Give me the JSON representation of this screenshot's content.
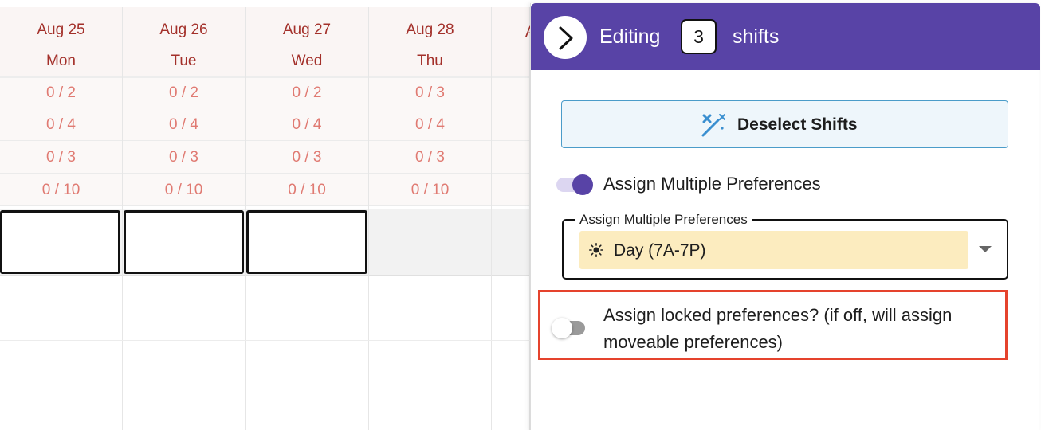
{
  "schedule": {
    "days": [
      {
        "date": "Aug 25",
        "weekday": "Mon",
        "counts": [
          "0 / 2",
          "0 / 4",
          "0 / 3",
          "0 / 10"
        ]
      },
      {
        "date": "Aug 26",
        "weekday": "Tue",
        "counts": [
          "0 / 2",
          "0 / 4",
          "0 / 3",
          "0 / 10"
        ]
      },
      {
        "date": "Aug 27",
        "weekday": "Wed",
        "counts": [
          "0 / 2",
          "0 / 4",
          "0 / 3",
          "0 / 10"
        ]
      },
      {
        "date": "Aug 28",
        "weekday": "Thu",
        "counts": [
          "0 / 3",
          "0 / 4",
          "0 / 3",
          "0 / 10"
        ]
      }
    ],
    "offscreen_fragment": "A",
    "colors": {
      "header_text": "#a3302a",
      "count_text": "#e07a72",
      "selected_border": "#111111"
    }
  },
  "panel": {
    "header": {
      "back_icon": "chevron-right-icon",
      "editing_label": "Editing",
      "selected_count": "3",
      "shifts_label": "shifts",
      "background": "#5843a6"
    },
    "deselect_button": {
      "label": "Deselect Shifts",
      "icon": "magic-wand-icon"
    },
    "multiple_preferences": {
      "toggle_on": true,
      "label": "Assign Multiple Preferences"
    },
    "preference_select": {
      "legend": "Assign Multiple Preferences",
      "selected_value": "Day (7A-7P)",
      "selected_icon": "sun-icon",
      "chip_color": "#fcecbf"
    },
    "locked_preferences": {
      "toggle_on": false,
      "label": "Assign locked preferences? (if off, will assign moveable preferences)",
      "highlight_color": "#e5432d"
    }
  }
}
